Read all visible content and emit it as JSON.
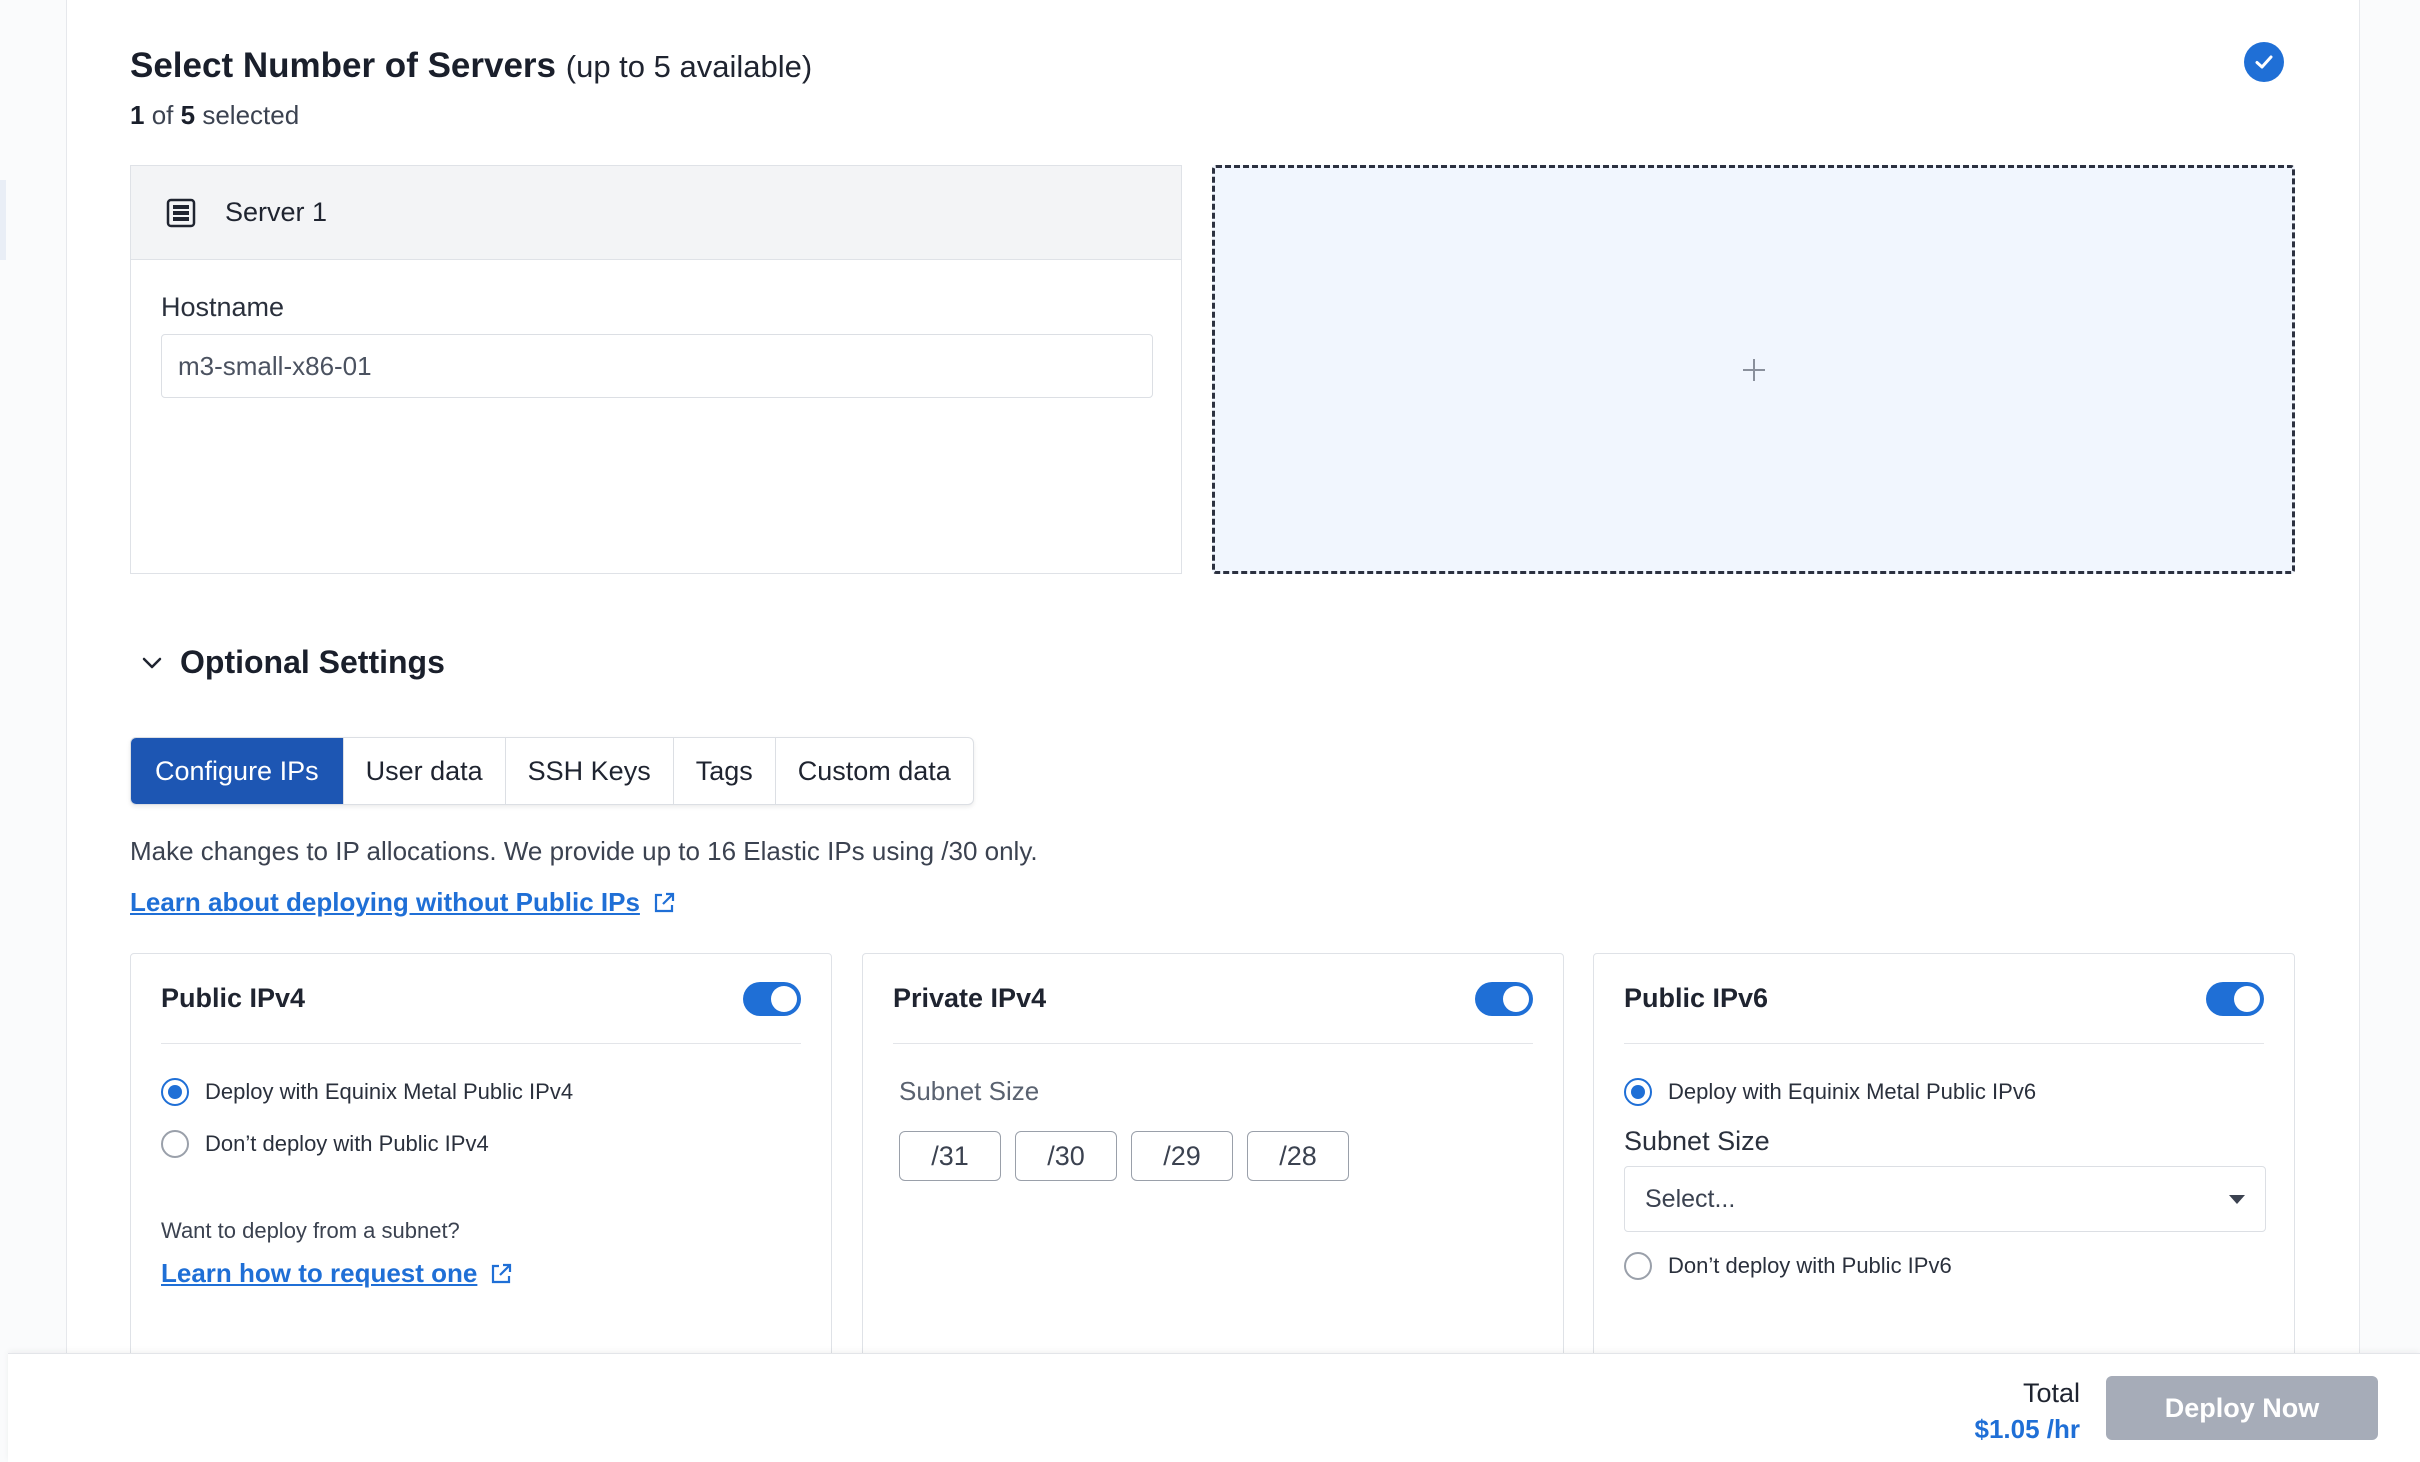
{
  "servers": {
    "title": "Select Number of Servers",
    "title_note": "(up to 5 available)",
    "selected_num": "1",
    "selected_of": "of",
    "selected_total": "5",
    "selected_word": "selected",
    "server_name": "Server 1",
    "hostname_label": "Hostname",
    "hostname_value": "m3-small-x86-01",
    "add_icon": "plus-icon",
    "status_icon": "check-circle-icon"
  },
  "optional": {
    "title": "Optional Settings",
    "tabs": [
      {
        "label": "Configure IPs",
        "active": true
      },
      {
        "label": "User data",
        "active": false
      },
      {
        "label": "SSH Keys",
        "active": false
      },
      {
        "label": "Tags",
        "active": false
      },
      {
        "label": "Custom data",
        "active": false
      }
    ],
    "description": "Make changes to IP allocations. We provide up to 16 Elastic IPs using /30 only.",
    "learn_link": "Learn about deploying without Public IPs"
  },
  "ip_cards": {
    "public_ipv4": {
      "title": "Public IPv4",
      "enabled": true,
      "option_deploy": "Deploy with Equinix Metal Public IPv4",
      "option_no_deploy": "Don’t deploy with Public IPv4",
      "question": "Want to deploy from a subnet?",
      "link": "Learn how to request one"
    },
    "private_ipv4": {
      "title": "Private IPv4",
      "enabled": true,
      "subnet_label": "Subnet Size",
      "subnets": [
        "/31",
        "/30",
        "/29",
        "/28"
      ]
    },
    "public_ipv6": {
      "title": "Public IPv6",
      "enabled": true,
      "option_deploy": "Deploy with Equinix Metal Public IPv6",
      "subnet_label": "Subnet Size",
      "select_placeholder": "Select...",
      "option_no_deploy": "Don’t deploy with Public IPv6"
    }
  },
  "footer": {
    "total_label": "Total",
    "total_price": "$1.05 /hr",
    "deploy_label": "Deploy Now"
  },
  "colors": {
    "accent": "#1f6fd6",
    "tab_active": "#1d56b3",
    "deploy_disabled": "#a6acb8"
  }
}
